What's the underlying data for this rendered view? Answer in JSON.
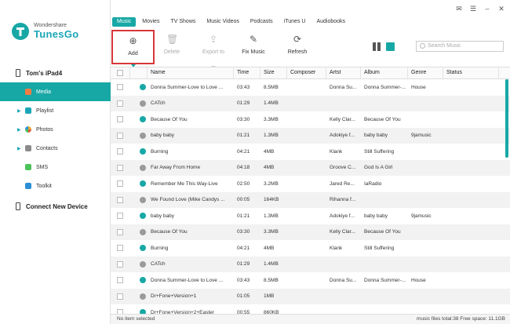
{
  "app": {
    "brand": "Wondershare",
    "name": "TunesGo",
    "accent": "#17a8a6"
  },
  "sidebar": {
    "device": "Tom's iPad4",
    "items": [
      {
        "label": "Media",
        "icon": "music-icon",
        "active": true,
        "color": "#f47b44"
      },
      {
        "label": "Playlist",
        "icon": "playlist-icon",
        "active": false,
        "color": "#1aa6b7"
      },
      {
        "label": "Photos",
        "icon": "photos-icon",
        "active": false,
        "color": "#e9b02f"
      },
      {
        "label": "Contacts",
        "icon": "contacts-icon",
        "active": false,
        "color": "#8b8b8b"
      },
      {
        "label": "SMS",
        "icon": "sms-icon",
        "active": false,
        "color": "#4cc35b"
      },
      {
        "label": "Toolkit",
        "icon": "toolkit-icon",
        "active": false,
        "color": "#2b8fd6"
      }
    ],
    "connect": "Connect New Device"
  },
  "tabs": [
    "Music",
    "Movies",
    "TV Shows",
    "Music Videos",
    "Podcasts",
    "iTunes U",
    "Audiobooks"
  ],
  "toolbar": {
    "add": "Add",
    "delete": "Delete",
    "export": "Export to",
    "fix": "Fix Music",
    "refresh": "Refresh",
    "search_placeholder": "Search Music"
  },
  "table": {
    "headers": [
      "Name",
      "Time",
      "Size",
      "Composer",
      "Artst",
      "Album",
      "Genre",
      "Status"
    ],
    "rows": [
      [
        "Donna Summer-Love to Love ...",
        "03:43",
        "8.5MB",
        "",
        "Donna Su...",
        "Donna Summer-...",
        "House",
        ""
      ],
      [
        "CATch",
        "01:29",
        "1.4MB",
        "",
        "",
        "",
        "",
        ""
      ],
      [
        "Because Of You",
        "03:30",
        "3.3MB",
        "",
        "Kelly Clar...",
        "Because Of You",
        "",
        ""
      ],
      [
        " baby baby",
        "01:21",
        "1.3MB",
        "",
        "Adokiye f...",
        "baby baby",
        "9jamusic",
        ""
      ],
      [
        "Burning",
        "04:21",
        "4MB",
        "",
        "Klank",
        "Still Suffering",
        "",
        ""
      ],
      [
        "Far Away From Home",
        "04:18",
        "4MB",
        "",
        "Groove C...",
        "God Is A Girl",
        "",
        ""
      ],
      [
        "Remember Me This Way-Live",
        "02:50",
        "3.2MB",
        "",
        "Jared Re...",
        "IaRadio",
        "",
        ""
      ],
      [
        "We Found Love (Mike Candys ...",
        "00:05",
        "164KB",
        "",
        "Rihanna f...",
        "",
        "",
        ""
      ],
      [
        "baby baby",
        "01:21",
        "1.3MB",
        "",
        "Adokiye f...",
        "baby baby",
        "9jamusic",
        ""
      ],
      [
        "Because Of You",
        "03:30",
        "3.3MB",
        "",
        "Kelly Clar...",
        "Because Of You",
        "",
        ""
      ],
      [
        "Burning",
        "04:21",
        "4MB",
        "",
        "Klank",
        "Still Suffering",
        "",
        ""
      ],
      [
        "CATch",
        "01:29",
        "1.4MB",
        "",
        "",
        "",
        "",
        ""
      ],
      [
        "Donna Summer-Love to Love ...",
        "03:43",
        "8.5MB",
        "",
        "Donna Su...",
        "Donna Summer-...",
        "House",
        ""
      ],
      [
        "Dr+Fone+Version+1",
        "01:05",
        "1MB",
        "",
        "",
        "",
        "",
        ""
      ],
      [
        "Dr+Fone+Version+2+Easter",
        "00:55",
        "860KB",
        "",
        "",
        "",
        "",
        ""
      ]
    ]
  },
  "status": {
    "left": "No item selected",
    "right": "music files total:38     Free space: 11.1GB"
  }
}
